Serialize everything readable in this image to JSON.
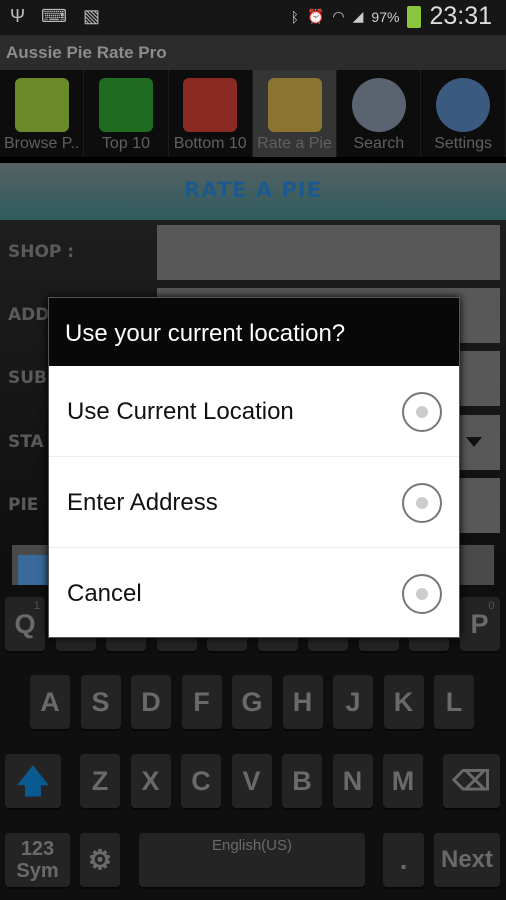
{
  "status_bar": {
    "battery": "97%",
    "time": "23:31",
    "icons": [
      "usb-icon",
      "keyboard-icon",
      "image-icon",
      "bluetooth-icon",
      "alarm-icon",
      "wifi-icon",
      "signal-icon",
      "battery-charging-icon"
    ]
  },
  "app": {
    "title": "Aussie Pie Rate Pro"
  },
  "tabs": [
    {
      "label": "Browse P..",
      "icon": "binoculars-icon",
      "color": "#6a8a2a"
    },
    {
      "label": "Top 10",
      "icon": "thumbs-up-icon",
      "color": "#1f6b1f"
    },
    {
      "label": "Bottom 10",
      "icon": "thumbs-down-icon",
      "color": "#8a2a22"
    },
    {
      "label": "Rate a Pie",
      "icon": "stars-icon",
      "color": "#8a7430",
      "selected": true
    },
    {
      "label": "Search",
      "icon": "magnifier-icon",
      "color": "#5a6470"
    },
    {
      "label": "Settings",
      "icon": "gear-icon",
      "color": "#3a5a80"
    }
  ],
  "header": {
    "title": "RATE A PIE"
  },
  "form": {
    "shop_label": "SHOP :",
    "address_label": "ADD",
    "suburb_label": "SUB",
    "state_label": "STA",
    "pie_label": "PIE"
  },
  "dialog": {
    "title": "Use your current location?",
    "options": [
      "Use Current Location",
      "Enter Address",
      "Cancel"
    ]
  },
  "keyboard": {
    "row1": [
      "Q",
      "",
      "",
      "",
      "",
      "",
      "",
      "",
      "",
      "P"
    ],
    "row1_hints": {
      "Q": "1",
      "P": "0"
    },
    "row2": [
      "A",
      "S",
      "D",
      "F",
      "G",
      "H",
      "J",
      "K",
      "L"
    ],
    "row3": [
      "Z",
      "X",
      "C",
      "V",
      "B",
      "N",
      "M"
    ],
    "sym": "123\nSym",
    "space": "English(US)",
    "period": ".",
    "next": "Next",
    "shift_color": "#0a5a92"
  }
}
